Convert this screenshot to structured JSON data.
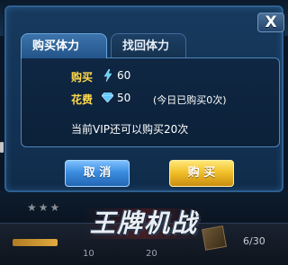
{
  "dialog": {
    "close_label": "X",
    "tabs": [
      {
        "label": "购买体力",
        "active": true
      },
      {
        "label": "找回体力",
        "active": false
      }
    ],
    "buy_row": {
      "label": "购买",
      "icon": "lightning-icon",
      "value": "60"
    },
    "cost_row": {
      "label": "花费",
      "icon": "diamond-icon",
      "value": "50",
      "note": "(今日已购买0次)"
    },
    "vip_info": "当前VIP还可以购买20次",
    "cancel_label": "取 消",
    "buy_label": "购 买"
  },
  "background": {
    "logo_text": "王牌机战",
    "left_number": "10",
    "mid_number": "20",
    "count": "6/30"
  },
  "colors": {
    "accent_label": "#ffd84a",
    "cancel_button": "#3b8de0",
    "buy_button": "#f2c12b",
    "dialog_bg": "#173a5e"
  }
}
